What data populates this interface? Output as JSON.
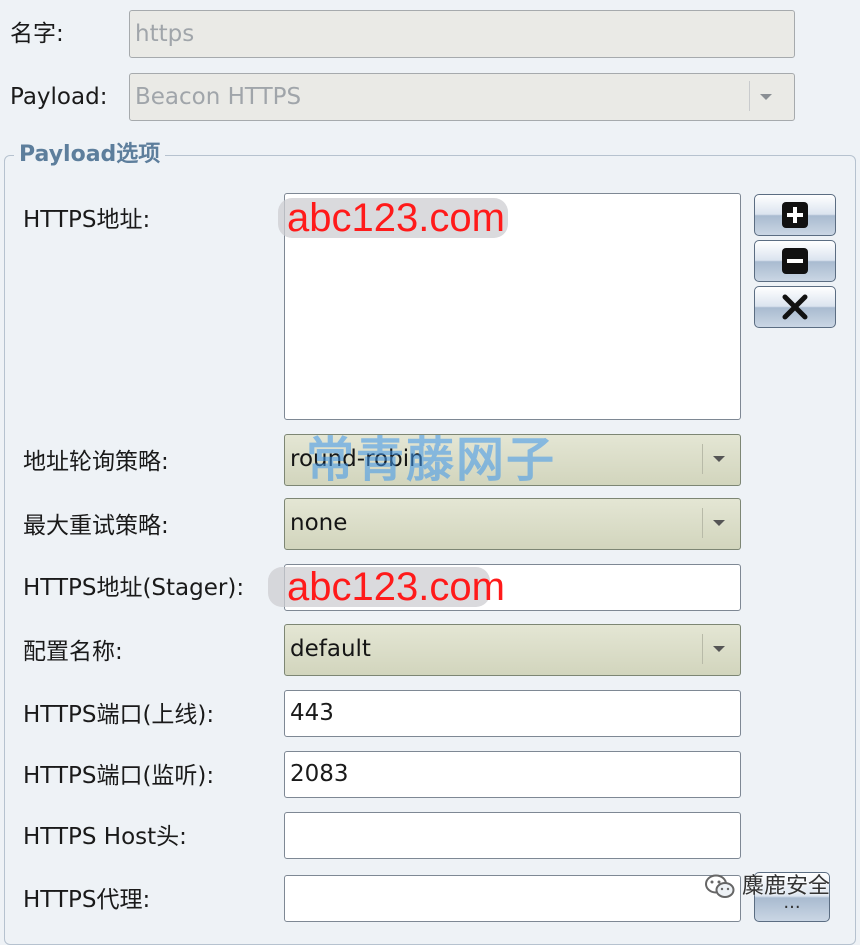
{
  "form": {
    "name_label": "名字:",
    "name_value": "https",
    "payload_label": "Payload:",
    "payload_value": "Beacon HTTPS"
  },
  "group": {
    "title": "Payload选项"
  },
  "options": {
    "hosts_label": "HTTPS地址:",
    "hosts_items": [],
    "rotate_label": "地址轮询策略:",
    "rotate_value": "round-robin",
    "retry_label": "最大重试策略:",
    "retry_value": "none",
    "stager_label": "HTTPS地址(Stager):",
    "stager_value": "",
    "profile_label": "配置名称:",
    "profile_value": "default",
    "port_bind_label": "HTTPS端口(上线):",
    "port_bind_value": "443",
    "port_listen_label": "HTTPS端口(监听):",
    "port_listen_value": "2083",
    "host_header_label": "HTTPS Host头:",
    "host_header_value": "",
    "proxy_label": "HTTPS代理:",
    "proxy_value": "",
    "proxy_button_label": "..."
  },
  "overlays": {
    "watermark_text_1": "abc123.com",
    "watermark_text_2": "abc123.com",
    "watermark_cn": "常青藤网子",
    "footer_brand": "麋鹿安全"
  },
  "colors": {
    "watermark_red": "#ff1a1a",
    "group_title": "#5d7e9c"
  },
  "icons": {
    "add": "plus-icon",
    "remove": "minus-icon",
    "clear": "x-icon",
    "combo": "chevron-down-icon"
  }
}
